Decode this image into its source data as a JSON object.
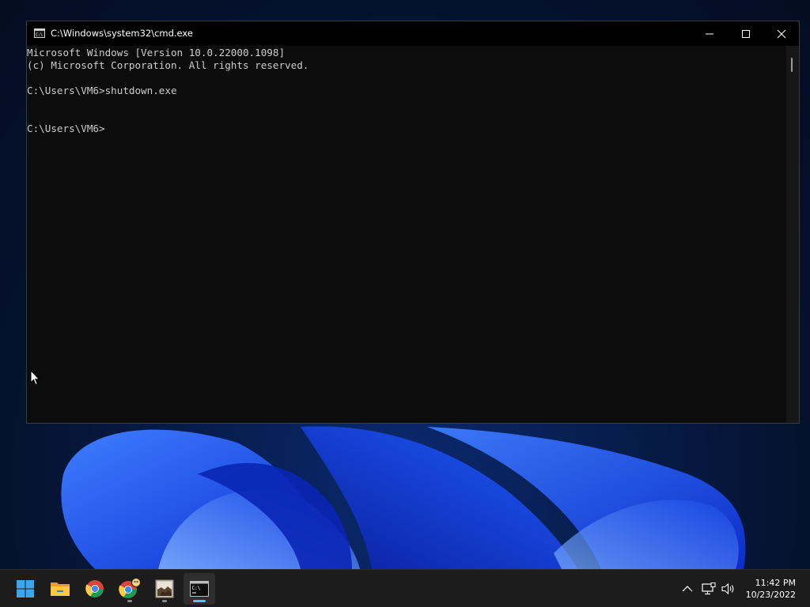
{
  "window": {
    "title": "C:\\Windows\\system32\\cmd.exe",
    "icon": "cmd-icon",
    "controls": {
      "minimize_icon": "minimize-icon",
      "maximize_icon": "maximize-icon",
      "close_icon": "close-icon"
    }
  },
  "console": {
    "lines": [
      "Microsoft Windows [Version 10.0.22000.1098]",
      "(c) Microsoft Corporation. All rights reserved.",
      "",
      "C:\\Users\\VM6>shutdown.exe",
      "",
      "",
      "C:\\Users\\VM6>"
    ],
    "text_color": "#cccccc",
    "background": "#0c0c0c"
  },
  "taskbar": {
    "apps": [
      {
        "name": "start-button",
        "icon": "windows-start-icon",
        "running": false,
        "active": false
      },
      {
        "name": "file-explorer",
        "icon": "folder-icon",
        "running": false,
        "active": false
      },
      {
        "name": "chrome",
        "icon": "chrome-icon",
        "running": false,
        "active": false
      },
      {
        "name": "chrome-profile",
        "icon": "chrome-profile-icon",
        "running": true,
        "active": false
      },
      {
        "name": "image-app",
        "icon": "image-thumbnail-icon",
        "running": true,
        "active": false
      },
      {
        "name": "command-prompt",
        "icon": "terminal-icon",
        "running": true,
        "active": true
      }
    ],
    "tray": {
      "overflow_icon": "chevron-up-icon",
      "network_icon": "network-icon",
      "volume_icon": "volume-icon"
    },
    "clock": {
      "time": "11:42 PM",
      "date": "10/23/2022"
    },
    "accent_color": "#4cc2ff"
  }
}
